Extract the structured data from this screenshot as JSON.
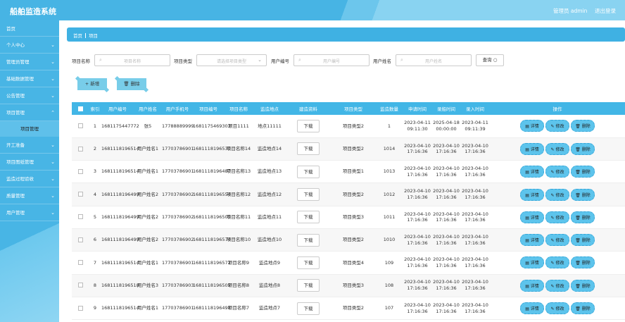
{
  "header": {
    "title": "船舶监造系统",
    "user": "管理员 admin",
    "logout": "退出登录"
  },
  "sidebar": {
    "home": "首页",
    "items": [
      {
        "label": "个人中心"
      },
      {
        "label": "管理员管理"
      },
      {
        "label": "基础数据管理"
      },
      {
        "label": "公告管理"
      },
      {
        "label": "项目管理",
        "sub": "项目管理"
      },
      {
        "label": "开工准备"
      },
      {
        "label": "项目图纸管理"
      },
      {
        "label": "监造过程验收"
      },
      {
        "label": "质量管理"
      },
      {
        "label": "用户管理"
      }
    ]
  },
  "breadcrumb": {
    "home": "首页",
    "current": "项目"
  },
  "search": {
    "name_label": "项目名称",
    "name_placeholder": "项目名称",
    "type_label": "项目类型",
    "type_placeholder": "请选择项目类型",
    "usercode_label": "用户编号",
    "usercode_placeholder": "用户编号",
    "username_label": "用户姓名",
    "username_placeholder": "用户姓名",
    "query_btn": "查询"
  },
  "actions": {
    "add": "新增",
    "delete": "删除"
  },
  "table": {
    "headers": [
      "索引",
      "用户编号",
      "用户姓名",
      "用户手机号",
      "项目编号",
      "项目名称",
      "监造地点",
      "建造资料",
      "项目类型",
      "监造数量",
      "申请时间",
      "录船时间",
      "录入时间",
      "操作"
    ],
    "download": "下载",
    "detail": "详情",
    "edit": "修改",
    "remove": "删除",
    "rows": [
      {
        "idx": "1",
        "ucode": "1681175447772",
        "uname": "张5",
        "phone": "17788889999",
        "pcode": "1681175469303",
        "pname": "项目1111",
        "place": "地点11111",
        "ptype": "项目类型2",
        "qty": "1",
        "t1": "2023-04-11 09:11:30",
        "t2": "2025-04-18 00:00:00",
        "t3": "2023-04-11 09:11:39"
      },
      {
        "idx": "2",
        "ucode": "1681118196514",
        "uname": "用户姓名1",
        "phone": "17703786901",
        "pcode": "1681118196531",
        "pname": "项目名称14",
        "place": "监造地点14",
        "ptype": "项目类型2",
        "qty": "1014",
        "t1": "2023-04-10 17:16:36",
        "t2": "2023-04-10 17:16:36",
        "t3": "2023-04-10 17:16:36"
      },
      {
        "idx": "3",
        "ucode": "1681118196514",
        "uname": "用户姓名1",
        "phone": "17703786901",
        "pcode": "1681118196487",
        "pname": "项目名称13",
        "place": "监造地点13",
        "ptype": "项目类型1",
        "qty": "1013",
        "t1": "2023-04-10 17:16:36",
        "t2": "2023-04-10 17:16:36",
        "t3": "2023-04-10 17:16:36"
      },
      {
        "idx": "4",
        "ucode": "1681118196499",
        "uname": "用户姓名2",
        "phone": "17703786902",
        "pcode": "1681118196554",
        "pname": "项目名称12",
        "place": "监造地点12",
        "ptype": "项目类型2",
        "qty": "1012",
        "t1": "2023-04-10 17:16:36",
        "t2": "2023-04-10 17:16:36",
        "t3": "2023-04-10 17:16:36"
      },
      {
        "idx": "5",
        "ucode": "1681118196499",
        "uname": "用户姓名2",
        "phone": "17703786902",
        "pcode": "1681118196505",
        "pname": "项目名称11",
        "place": "监造地点11",
        "ptype": "项目类型3",
        "qty": "1011",
        "t1": "2023-04-10 17:16:36",
        "t2": "2023-04-10 17:16:36",
        "t3": "2023-04-10 17:16:36"
      },
      {
        "idx": "6",
        "ucode": "1681118196499",
        "uname": "用户姓名2",
        "phone": "17703786902",
        "pcode": "1681118196574",
        "pname": "项目名称10",
        "place": "监造地点10",
        "ptype": "项目类型2",
        "qty": "1010",
        "t1": "2023-04-10 17:16:36",
        "t2": "2023-04-10 17:16:36",
        "t3": "2023-04-10 17:16:36"
      },
      {
        "idx": "7",
        "ucode": "1681118196514",
        "uname": "用户姓名1",
        "phone": "17703786901",
        "pcode": "1681118196572",
        "pname": "项目名称9",
        "place": "监造地点9",
        "ptype": "项目类型4",
        "qty": "109",
        "t1": "2023-04-10 17:16:36",
        "t2": "2023-04-10 17:16:36",
        "t3": "2023-04-10 17:16:36"
      },
      {
        "idx": "8",
        "ucode": "1681118196518",
        "uname": "用户姓名3",
        "phone": "17703786903",
        "pcode": "1681118196509",
        "pname": "项目名称8",
        "place": "监造地点8",
        "ptype": "项目类型3",
        "qty": "108",
        "t1": "2023-04-10 17:16:36",
        "t2": "2023-04-10 17:16:36",
        "t3": "2023-04-10 17:16:36"
      },
      {
        "idx": "9",
        "ucode": "1681118196514",
        "uname": "用户姓名1",
        "phone": "17703786901",
        "pcode": "1681118196498",
        "pname": "项目名称7",
        "place": "监造地点7",
        "ptype": "项目类型2",
        "qty": "107",
        "t1": "2023-04-10 17:16:36",
        "t2": "2023-04-10 17:16:36",
        "t3": "2023-04-10 17:16:36"
      }
    ]
  }
}
